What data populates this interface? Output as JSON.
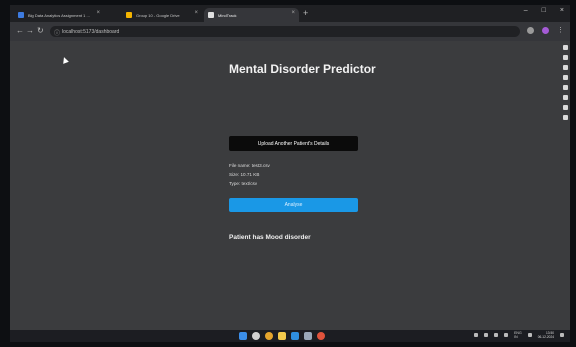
{
  "browser": {
    "tabs": [
      {
        "label": "Big Data Analytics Assignment 1 ...",
        "favicon_color": "#3d7be0"
      },
      {
        "label": "Group 10 - Google Drive",
        "favicon_color": "#f4b400"
      },
      {
        "label": "MindTrack",
        "favicon_color": "#e0e0e0"
      }
    ],
    "new_tab": "+",
    "window_controls": [
      "–",
      "□",
      "×"
    ],
    "url": "localhost:5173/dashboard"
  },
  "page": {
    "title": "Mental Disorder Predictor",
    "upload_button": "Upload Another Patient's Details",
    "file": {
      "name": "File name: test3.csv",
      "size": "Size: 10.71 KB",
      "type": "Type: text/csv"
    },
    "analyse_button": "Analyse",
    "result": "Patient has Mood disorder"
  },
  "taskbar": {
    "icons": [
      {
        "name": "windows-start-icon",
        "color": "#3b8eea"
      },
      {
        "name": "search-icon",
        "color": "#d0d0d0"
      },
      {
        "name": "chrome-icon",
        "color": "#e5a52d"
      },
      {
        "name": "file-explorer-icon",
        "color": "#f2c94c"
      },
      {
        "name": "vscode-icon",
        "color": "#2f8fe0"
      },
      {
        "name": "store-icon",
        "color": "#9aa7b8"
      },
      {
        "name": "chrome-profile-icon",
        "color": "#e0533c"
      }
    ],
    "tray_lang": "ENG\nIN",
    "time": "13:50",
    "date": "06-12-2024"
  }
}
